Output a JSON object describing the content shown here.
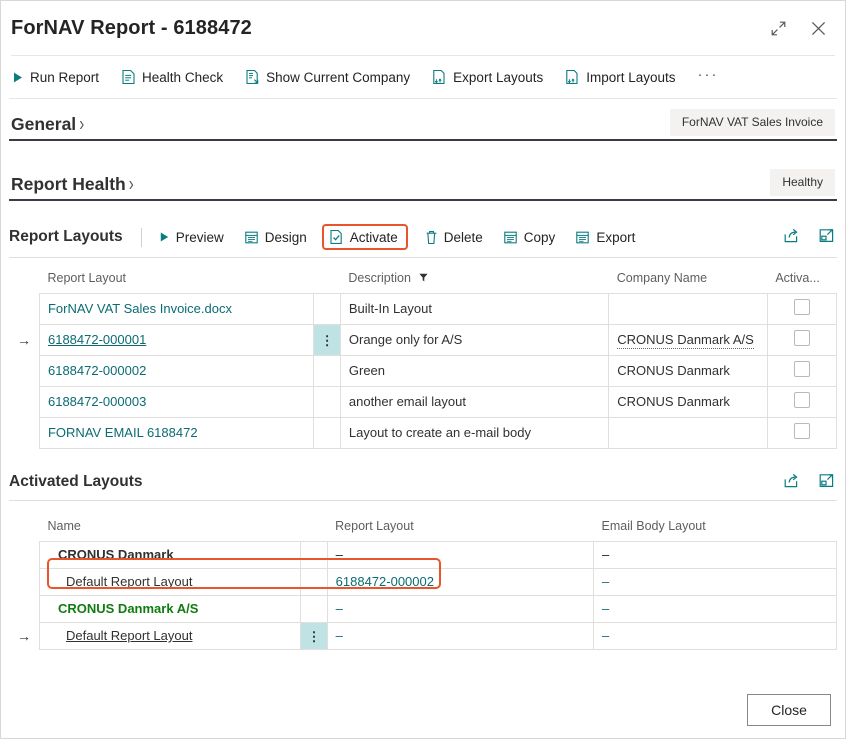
{
  "window": {
    "title": "ForNAV Report - 6188472",
    "expand_icon": "expand-diagonal-icon",
    "close_icon": "close-icon"
  },
  "actionbar": {
    "items": [
      {
        "label": "Run Report",
        "icon": "play-icon"
      },
      {
        "label": "Health Check",
        "icon": "document-check-icon"
      },
      {
        "label": "Show Current Company",
        "icon": "document-company-icon"
      },
      {
        "label": "Export Layouts",
        "icon": "document-export-icon"
      },
      {
        "label": "Import Layouts",
        "icon": "document-import-icon"
      }
    ],
    "overflow_label": "···"
  },
  "sections": {
    "general": {
      "title": "General",
      "badge": "ForNAV VAT Sales Invoice"
    },
    "report_health": {
      "title": "Report Health",
      "badge": "Healthy"
    }
  },
  "report_layouts": {
    "title": "Report Layouts",
    "actions": [
      {
        "label": "Preview",
        "icon": "play-icon",
        "highlighted": false
      },
      {
        "label": "Design",
        "icon": "layout-design-icon",
        "highlighted": false
      },
      {
        "label": "Activate",
        "icon": "document-check-icon",
        "highlighted": true
      },
      {
        "label": "Delete",
        "icon": "trash-icon",
        "highlighted": false
      },
      {
        "label": "Copy",
        "icon": "layout-copy-icon",
        "highlighted": false
      },
      {
        "label": "Export",
        "icon": "layout-export-icon",
        "highlighted": false
      }
    ],
    "right_icons": [
      {
        "name": "share-icon"
      },
      {
        "name": "open-in-new-window-icon"
      }
    ],
    "columns": [
      "Report Layout",
      "Description",
      "Company Name",
      "Activa..."
    ],
    "description_filter_icon": "filter-icon",
    "rows": [
      {
        "selected": false,
        "report_layout": "ForNAV VAT Sales Invoice.docx",
        "underlined": false,
        "description": "Built-In Layout",
        "company": "",
        "company_dotted": false,
        "activated": false
      },
      {
        "selected": true,
        "report_layout": "6188472-000001",
        "underlined": true,
        "description": "Orange only for A/S",
        "company": "CRONUS Danmark A/S",
        "company_dotted": true,
        "activated": false
      },
      {
        "selected": false,
        "report_layout": "6188472-000002",
        "underlined": false,
        "description": "Green",
        "company": "CRONUS Danmark",
        "company_dotted": false,
        "activated": false
      },
      {
        "selected": false,
        "report_layout": "6188472-000003",
        "underlined": false,
        "description": "another email layout",
        "company": "CRONUS Danmark",
        "company_dotted": false,
        "activated": false
      },
      {
        "selected": false,
        "report_layout": "FORNAV EMAIL 6188472",
        "underlined": false,
        "description": "Layout to create an e-mail body",
        "company": "",
        "company_dotted": false,
        "activated": false
      }
    ]
  },
  "activated_layouts": {
    "title": "Activated Layouts",
    "right_icons": [
      {
        "name": "share-icon"
      },
      {
        "name": "open-in-new-window-icon"
      }
    ],
    "columns": [
      "Name",
      "Report Layout",
      "Email Body Layout"
    ],
    "rows": [
      {
        "kind": "group",
        "selected": false,
        "name": "CRONUS Danmark",
        "name_style": "bold",
        "report_layout": "–",
        "report_layout_link": false,
        "email_body_layout": "–",
        "highlighted": false
      },
      {
        "kind": "detail",
        "selected": false,
        "name": "Default Report Layout",
        "name_style": "normal",
        "report_layout": "6188472-000002",
        "report_layout_link": true,
        "email_body_layout": "–",
        "highlighted": true
      },
      {
        "kind": "group",
        "selected": false,
        "name": "CRONUS Danmark A/S",
        "name_style": "green-bold",
        "report_layout": "–",
        "report_layout_link": false,
        "email_body_layout": "–",
        "highlighted": false
      },
      {
        "kind": "detail",
        "selected": true,
        "name": "Default Report Layout",
        "name_style": "underline",
        "report_layout": "–",
        "report_layout_link": true,
        "email_body_layout": "–",
        "highlighted": false
      }
    ]
  },
  "footer": {
    "close_label": "Close"
  },
  "colors": {
    "accent_teal": "#0a6c73",
    "highlight_orange": "#e8552d",
    "selected_cell": "#bfe3e5",
    "group_green": "#107c10",
    "rule_dark": "#3b3a45"
  }
}
